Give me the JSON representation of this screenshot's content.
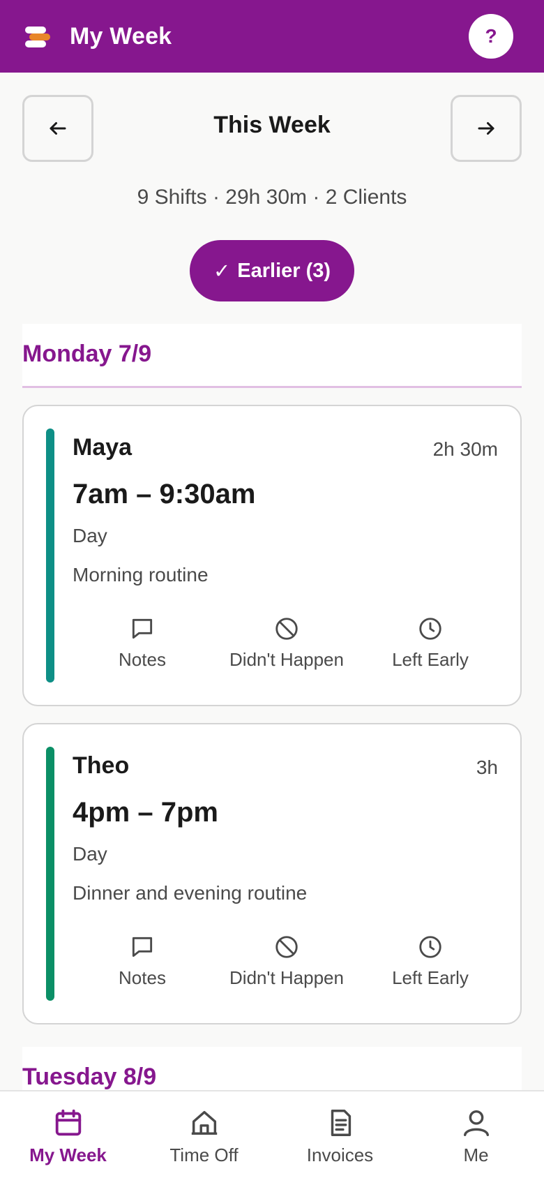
{
  "header": {
    "title": "My Week",
    "help_label": "?"
  },
  "week": {
    "title": "This Week",
    "summary": "9 Shifts · 29h 30m · 2 Clients",
    "earlier_label": "Earlier (3)",
    "earlier_check": "✓"
  },
  "days": [
    {
      "label": "Monday 7/9",
      "shifts": [
        {
          "client": "Maya",
          "duration": "2h 30m",
          "time": "7am – 9:30am",
          "type": "Day",
          "description": "Morning routine",
          "accent_color": "#0e8f86",
          "actions": [
            "Notes",
            "Didn't Happen",
            "Left Early"
          ]
        },
        {
          "client": "Theo",
          "duration": "3h",
          "time": "4pm – 7pm",
          "type": "Day",
          "description": "Dinner and evening routine",
          "accent_color": "#0b8f66",
          "actions": [
            "Notes",
            "Didn't Happen",
            "Left Early"
          ]
        }
      ]
    },
    {
      "label": "Tuesday 8/9",
      "shifts": []
    }
  ],
  "bottom_nav": [
    {
      "label": "My Week",
      "icon": "calendar-icon",
      "active": true
    },
    {
      "label": "Time Off",
      "icon": "house-icon",
      "active": false
    },
    {
      "label": "Invoices",
      "icon": "document-icon",
      "active": false
    },
    {
      "label": "Me",
      "icon": "person-icon",
      "active": false
    }
  ],
  "colors": {
    "brand": "#86178e",
    "accent_orange": "#e8862a",
    "text_secondary": "#4a4a4a"
  }
}
